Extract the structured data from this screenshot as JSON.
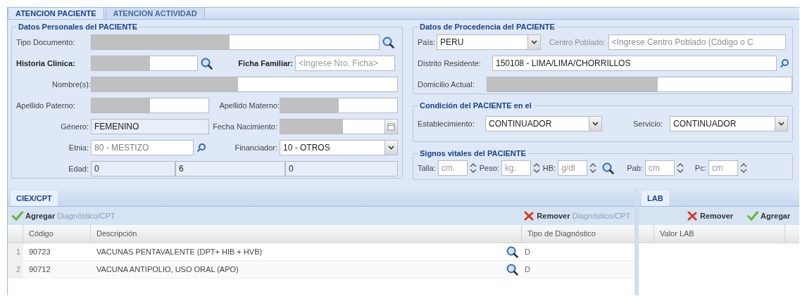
{
  "tabs": [
    {
      "label": "ATENCION PACIENTE",
      "selected": true
    },
    {
      "label": "ATENCION ACTIVIDAD",
      "selected": false
    }
  ],
  "personal": {
    "title": "Datos Personales del PACIENTE",
    "tipo_documento": {
      "label": "Tipo Documento:",
      "redacted": true
    },
    "historia_clinica": {
      "label": "Historia Clinica:",
      "redacted": true
    },
    "ficha_familiar": {
      "label": "Ficha Familiar:",
      "placeholder": "<Ingrese Nro. Ficha>"
    },
    "nombres": {
      "label": "Nombre(s):",
      "redacted": true
    },
    "apellido_paterno": {
      "label": "Apellido Paterno:",
      "redacted": true
    },
    "apellido_materno": {
      "label": "Apellido Materno:",
      "redacted": true
    },
    "genero": {
      "label": "Género:",
      "value": "FEMENINO"
    },
    "fecha_nacimiento": {
      "label": "Fecha Nacimiento:",
      "redacted": true
    },
    "etnia": {
      "label": "Etnia:",
      "value": "80 - MESTIZO",
      "disabled": true
    },
    "financiador": {
      "label": "Financiador:",
      "value": "10 - OTROS"
    },
    "edad": {
      "label": "Edad:",
      "values": [
        "0",
        "6",
        "0"
      ]
    }
  },
  "procedencia": {
    "title": "Datos de Procedencia del PACIENTE",
    "pais": {
      "label": "País:",
      "value": "PERU"
    },
    "centro_poblado": {
      "label": "Centro Poblado:",
      "placeholder": "<Ingrese Centro Poblado (Código o C",
      "disabled": true
    },
    "distrito": {
      "label": "Distrito Residente:",
      "value": "150108 - LIMA/LIMA/CHORRILLOS"
    },
    "domicilio": {
      "label": "Domicilio Actual:",
      "redacted": true
    }
  },
  "condicion": {
    "title": "Condición del PACIENTE en el",
    "establecimiento": {
      "label": "Establecimiento:",
      "value": "CONTINUADOR"
    },
    "servicio": {
      "label": "Servicio:",
      "value": "CONTINUADOR"
    }
  },
  "signos": {
    "title": "Signos vitales del PACIENTE",
    "fields": [
      {
        "label": "Talla:",
        "placeholder": "cm.",
        "search": false
      },
      {
        "label": "Peso:",
        "placeholder": "kg.",
        "search": false
      },
      {
        "label": "HB:",
        "placeholder": "g/dl",
        "search": true
      },
      {
        "label": "Pab:",
        "placeholder": "cm",
        "search": false
      },
      {
        "label": "Pc:",
        "placeholder": "cm",
        "search": false
      }
    ]
  },
  "ciex": {
    "tab": {
      "label": "CIEX/CPT",
      "selected": true
    },
    "add_button": "**Agregar** Diagnóstico/CPT",
    "remove_button": "**Remover** Diagnóstico/CPT",
    "columns": [
      "Código",
      "Descripción",
      "Tipo de Diagnóstico"
    ],
    "rows": [
      {
        "number": "1",
        "codigo": "90723",
        "descripcion": "VACUNAS PENTAVALENTE (DPT+ HIB + HVB)",
        "tipo": "D"
      },
      {
        "number": "2",
        "codigo": "90712",
        "descripcion": "VACUNA ANTIPOLIO, USO ORAL (APO)",
        "tipo": "D"
      }
    ]
  },
  "lab": {
    "tab": {
      "label": "LAB",
      "selected": true
    },
    "remove_button": "Remover",
    "add_button": "Agregar",
    "columns": [
      "Valor LAB"
    ]
  }
}
